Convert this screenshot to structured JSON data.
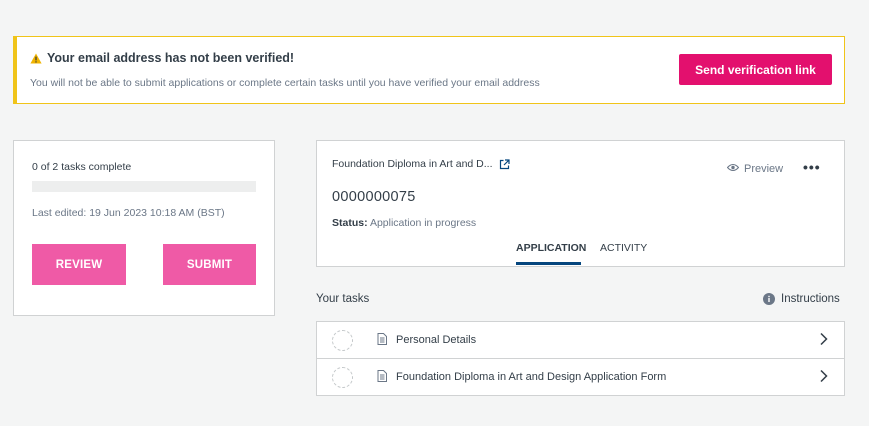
{
  "alert": {
    "title": "Your email address has not been verified!",
    "text": "You will not be able to submit applications or complete certain tasks until you have verified your email address",
    "button_label": "Send verification link",
    "icon": "warning-icon",
    "accent_color": "#f0c419"
  },
  "progress": {
    "tasks_text": "0 of 2 tasks complete",
    "completed": 0,
    "total": 2,
    "last_edited": "Last edited: 19 Jun 2023 10:18 AM (BST)",
    "review_label": "REVIEW",
    "submit_label": "SUBMIT"
  },
  "application": {
    "title": "Foundation Diploma in Art and D...",
    "id": "0000000075",
    "status_label": "Status:",
    "status_value": "Application in progress",
    "preview_label": "Preview",
    "more_label": "•••",
    "tabs": [
      {
        "label": "APPLICATION",
        "active": true
      },
      {
        "label": "ACTIVITY",
        "active": false
      }
    ]
  },
  "tasks": {
    "heading": "Your tasks",
    "instructions_label": "Instructions",
    "items": [
      {
        "label": "Personal Details"
      },
      {
        "label": "Foundation Diploma in Art and Design Application Form"
      }
    ]
  },
  "colors": {
    "brand_pink": "#e3106e",
    "button_pink": "#ef5aa6",
    "tab_underline": "#05467e",
    "background": "#f4f5f5"
  }
}
